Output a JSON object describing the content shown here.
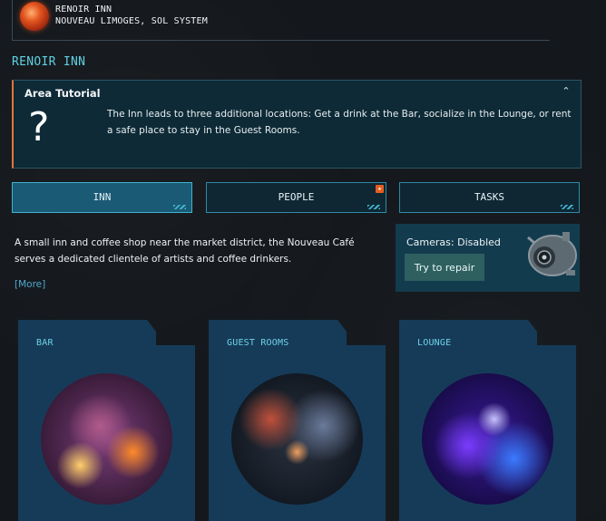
{
  "location": {
    "name": "RENOIR INN",
    "system": "NOUVEAU LIMOGES, SOL SYSTEM"
  },
  "page_title": "RENOIR INN",
  "tutorial": {
    "title": "Area Tutorial",
    "icon": "?",
    "collapse_glyph": "⌃",
    "text": "The Inn leads to three additional locations: Get a drink at the Bar, socialize in the Lounge, or rent a safe place to stay in the Guest Rooms."
  },
  "tabs": [
    {
      "label": "INN",
      "active": true
    },
    {
      "label": "PEOPLE",
      "active": false,
      "notification": true
    },
    {
      "label": "TASKS",
      "active": false
    }
  ],
  "description": "A small inn and coffee shop near the market district, the Nouveau Café serves a dedicated clientele of artists and coffee drinkers.",
  "more_link": "[More]",
  "camera": {
    "status": "Cameras: Disabled",
    "repair_label": "Try to repair"
  },
  "locations": [
    {
      "label": "BAR"
    },
    {
      "label": "GUEST ROOMS"
    },
    {
      "label": "LOUNGE"
    }
  ],
  "colors": {
    "accent_cyan": "#5fd2e2",
    "tutorial_border": "#e0763a",
    "notification": "#e55d1f"
  }
}
